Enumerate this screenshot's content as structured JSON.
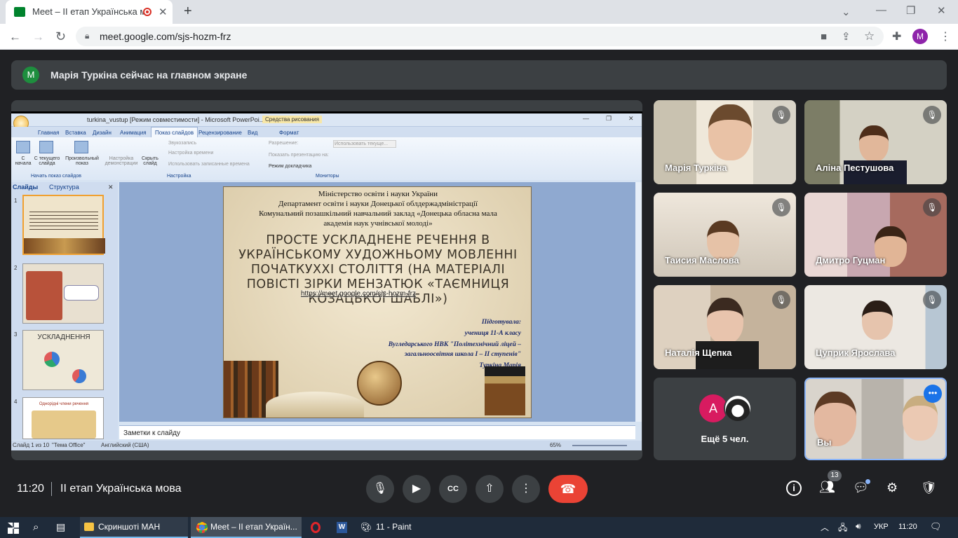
{
  "browser": {
    "tab_title": "Meet – II етап Українська м",
    "url": "meet.google.com/sjs-hozm-frz",
    "profile_initial": "M"
  },
  "meet": {
    "banner_avatar": "M",
    "banner_text": "Марія Туркіна сейчас на главном экране",
    "time": "11:20",
    "meeting_title": "II етап Українська мова",
    "participants_count": "13",
    "more_count": "Ещё 5 чел.",
    "more_avatar": "A",
    "tiles": [
      {
        "name": "Марія Туркіна"
      },
      {
        "name": "Аліна Пестушова"
      },
      {
        "name": "Таисия Маслова"
      },
      {
        "name": "Дмитро Гуцман"
      },
      {
        "name": "Наталія Щепка"
      },
      {
        "name": "Цуприк Ярослава"
      },
      {
        "name": "Вы"
      }
    ]
  },
  "ppt": {
    "window_title": "turkina_vustup [Режим совместимости] - Microsoft PowerPoi...",
    "context_tab": "Средства рисования",
    "tabs": [
      "Главная",
      "Вставка",
      "Дизайн",
      "Анимация",
      "Показ слайдов",
      "Рецензирование",
      "Вид",
      "Формат"
    ],
    "groups": [
      "Начать показ слайдов",
      "Настройка",
      "Мониторы"
    ],
    "buttons": [
      "С начала",
      "С текущего слайда",
      "Произвольный показ",
      "Настройка демонстрации",
      "Скрыть слайд"
    ],
    "options": [
      "Звукозапись",
      "Настройка времени",
      "Использовать записанные времена"
    ],
    "monitor_options": [
      "Разрешение:",
      "Использовать текуще...",
      "Показать презентацию на:",
      "Режим докладчика"
    ],
    "pane_tabs": [
      "Слайды",
      "Структура"
    ],
    "notes": "Заметки к слайду",
    "status_left": "Слайд 1 из 10",
    "status_theme": "\"Тема Office\"",
    "status_lang": "Английский (США)",
    "zoom": "65%",
    "thumb_3_title": "УСКЛАДНЕННЯ",
    "thumb_4_title": "Однорідні члени речення"
  },
  "slide": {
    "header_lines": [
      "Міністерство освіти і науки України",
      "Департамент освіти і науки Донецької облдержадміністрації",
      "Комунальний позашкільний навчальний заклад «Донецька обласна мала",
      "академія наук учнівської молоді»"
    ],
    "title": "ПРОСТЕ УСКЛАДНЕНЕ РЕЧЕННЯ В УКРАЇНСЬКОМУ ХУДОЖНЬОМУ МОВЛЕННІ ПОЧАТКУХХІ СТОЛІТТЯ (НА МАТЕРІАЛІ ПОВІСТІ ЗІРКИ МЕНЗАТЮК «ТАЄМНИЦЯ КОЗАЦЬКОЇ ШАБЛІ»)",
    "link": "https://meet.google.com/sjs-hozm-frz",
    "author_lines": [
      "Підготувала:",
      "учениця 11-А класу",
      "Вугледарського НВК \"Політехнічний ліцей –",
      "загальноосвітня школа I – II ступенів\"",
      "Туркіна Марія"
    ]
  },
  "taskbar": {
    "items": [
      "Скриншоті МАН",
      "Meet – II етап Україн...",
      "11 - Paint"
    ],
    "lang": "УКР",
    "time": "11:20"
  }
}
